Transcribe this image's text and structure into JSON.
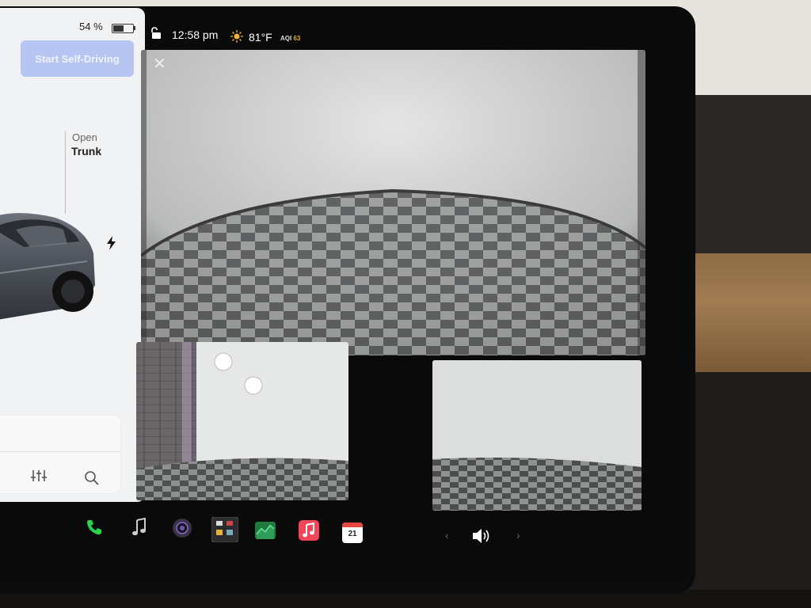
{
  "status": {
    "battery_percent": "54 %",
    "time": "12:58 pm",
    "temperature": "81°F",
    "aqi_label": "AQI",
    "aqi_value": "63"
  },
  "controls": {
    "self_driving_label": "Start Self-Driving",
    "trunk_action": "Open",
    "trunk_label": "Trunk"
  },
  "camera": {
    "close_icon": "close-icon",
    "views": [
      "main-camera-view",
      "left-repeater-view",
      "right-repeater-view"
    ]
  },
  "dock": {
    "icons": [
      "phone-icon",
      "music-note-icon",
      "camera-icon",
      "toybox-icon",
      "energy-icon",
      "apple-music-icon",
      "calendar-icon"
    ],
    "calendar_day": "21",
    "volume_icon": "volume-icon"
  },
  "colors": {
    "self_drive_bg": "#b6c5f2",
    "phone_green": "#2bd14b",
    "music_red": "#f44458",
    "aqi_color": "#d9b233"
  }
}
